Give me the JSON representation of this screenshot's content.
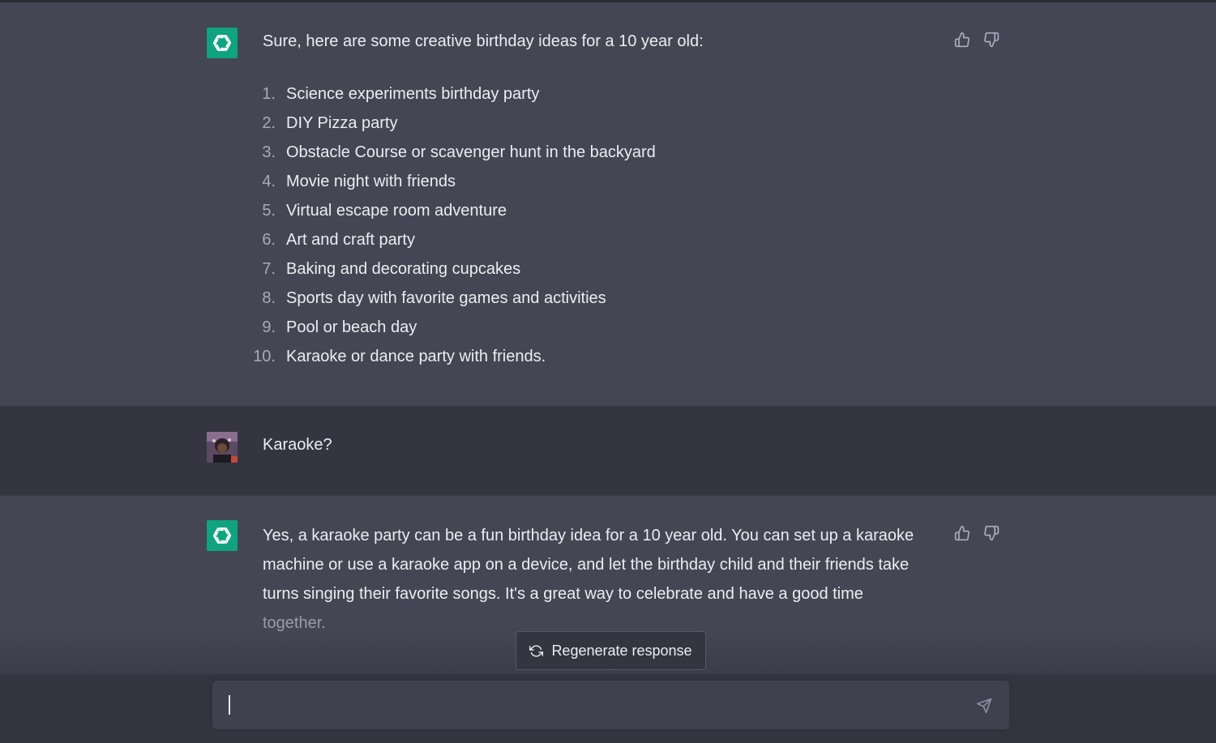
{
  "conversation": {
    "assistant_1": {
      "intro": "Sure, here are some creative birthday ideas for a 10 year old:",
      "ideas": [
        {
          "num": "1.",
          "text": "Science experiments birthday party"
        },
        {
          "num": "2.",
          "text": "DIY Pizza party"
        },
        {
          "num": "3.",
          "text": "Obstacle Course or scavenger hunt in the backyard"
        },
        {
          "num": "4.",
          "text": "Movie night with friends"
        },
        {
          "num": "5.",
          "text": "Virtual escape room adventure"
        },
        {
          "num": "6.",
          "text": "Art and craft party"
        },
        {
          "num": "7.",
          "text": "Baking and decorating cupcakes"
        },
        {
          "num": "8.",
          "text": "Sports day with favorite games and activities"
        },
        {
          "num": "9.",
          "text": "Pool or beach day"
        },
        {
          "num": "10.",
          "text": "Karaoke or dance party with friends."
        }
      ]
    },
    "user_1": {
      "text": "Karaoke?"
    },
    "assistant_2": {
      "lines": [
        "Yes, a karaoke party can be a fun birthday idea for a 10 year old. You can set up a karaoke",
        "machine or use a karaoke app on a device, and let the birthday child and their friends take",
        "turns singing their favorite songs. It's a great way to celebrate and have a good time",
        "together."
      ]
    }
  },
  "regenerate": {
    "label": "Regenerate response"
  },
  "composer": {
    "value": ""
  },
  "colors": {
    "assistant_bg": "#444654",
    "user_bg": "#343541",
    "brand_green": "#10a37f",
    "text": "#ececf1"
  },
  "icons": {
    "assistant_avatar": "openai-logo-icon",
    "thumbs_up": "thumbs-up-icon",
    "thumbs_down": "thumbs-down-icon",
    "regenerate": "refresh-icon",
    "send": "paper-plane-icon"
  }
}
